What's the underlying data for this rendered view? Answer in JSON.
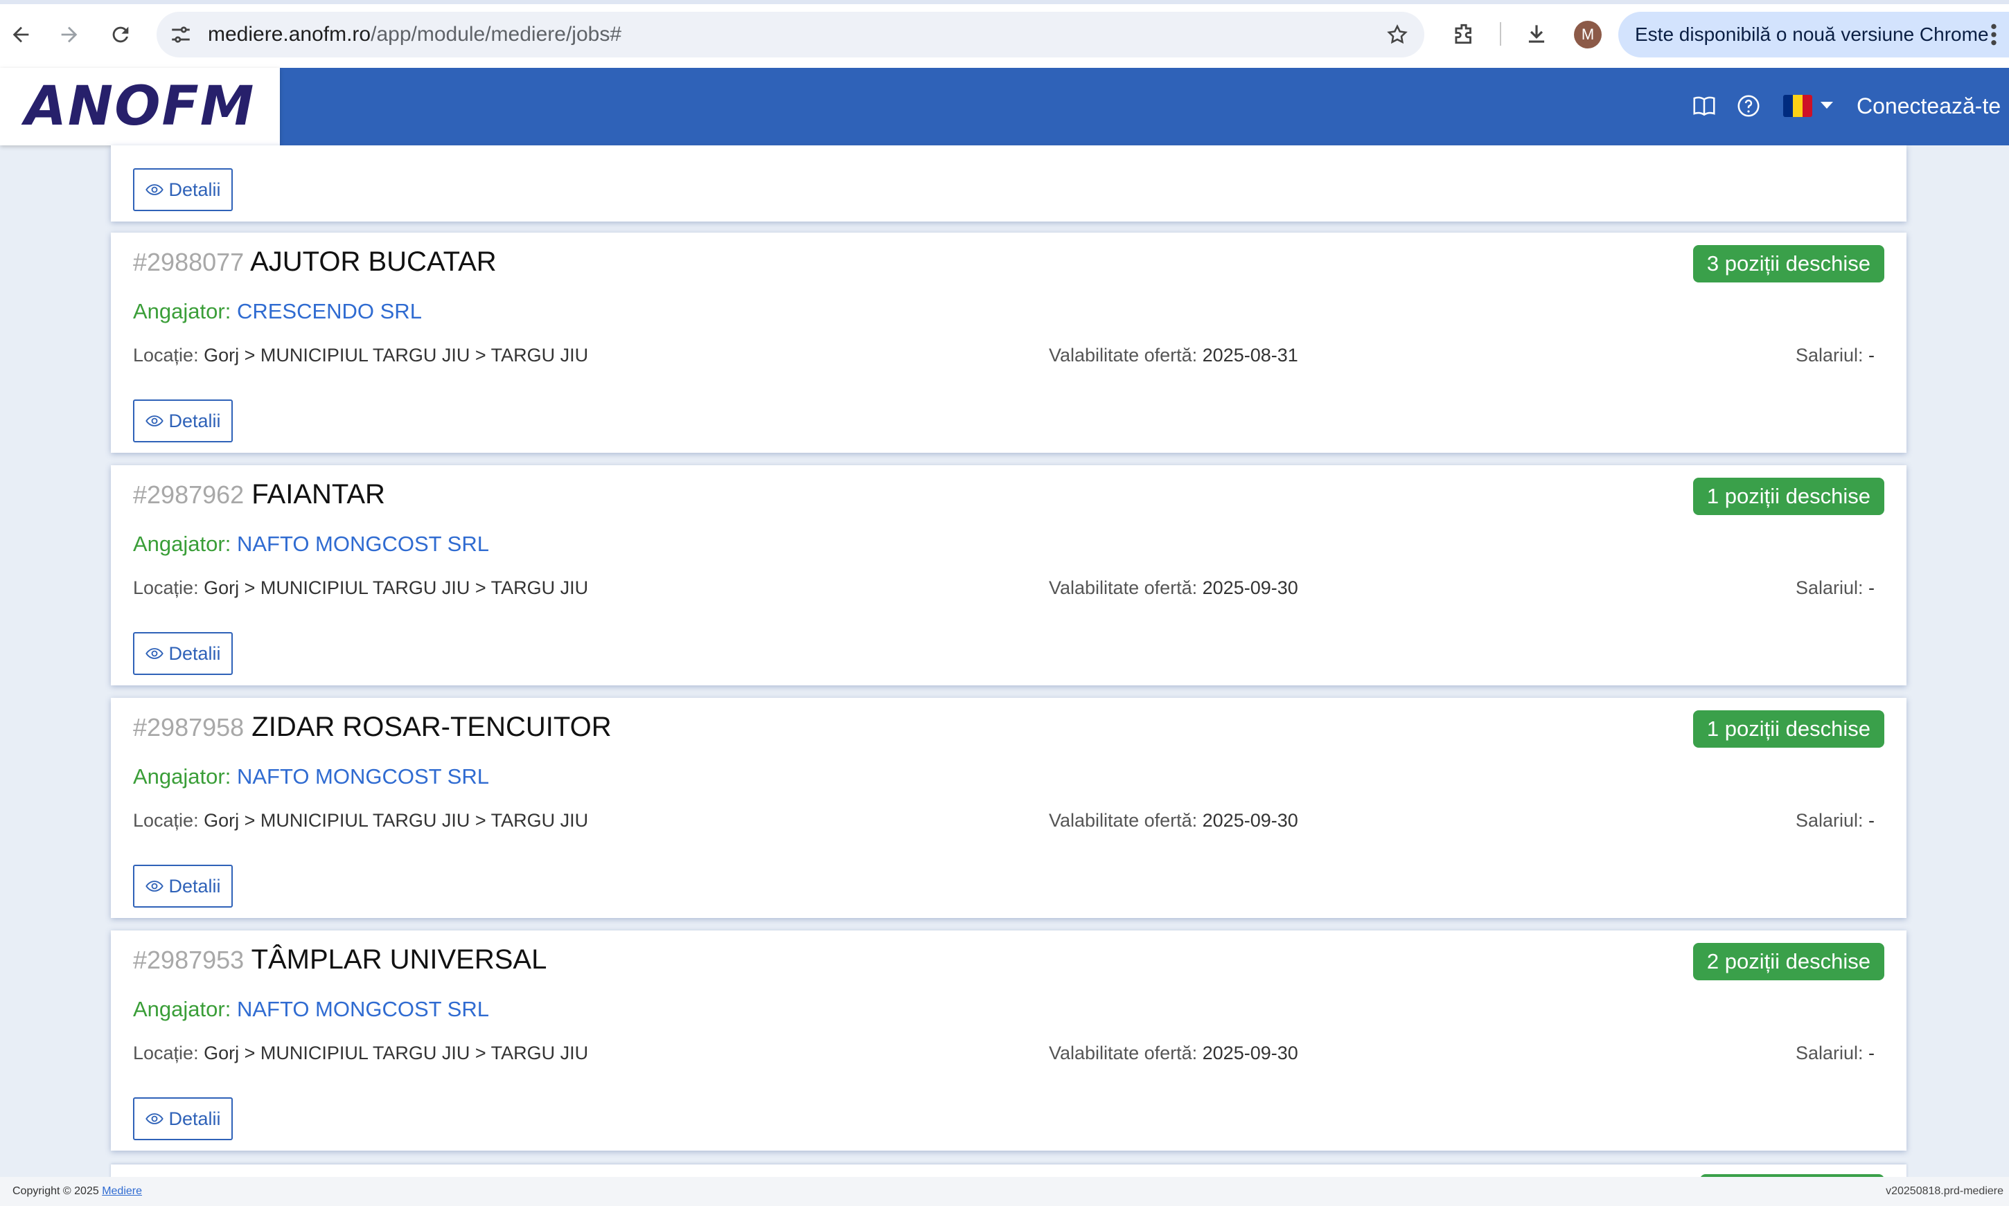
{
  "browser": {
    "url_host": "mediere.anofm.ro",
    "url_path": "/app/module/mediere/jobs#",
    "avatar_letter": "M",
    "update_notice": "Este disponibilă o nouă versiune Chrome"
  },
  "header": {
    "logo_text": "ANOFM",
    "login_label": "Conectează-te",
    "flag_colors": [
      "#002B7F",
      "#FCD116",
      "#CE1126"
    ]
  },
  "labels": {
    "employer": "Angajator: ",
    "location": "Locație: ",
    "validity": "Valabilitate ofertă: ",
    "salary": "Salariul: ",
    "details": "Detalii"
  },
  "jobs": [
    {
      "id": "#2988077",
      "title": "AJUTOR BUCATAR",
      "badge": "3 poziții deschise",
      "employer": "CRESCENDO SRL",
      "location": "Gorj > MUNICIPIUL TARGU JIU > TARGU JIU",
      "validity": "2025-08-31",
      "salary": "-"
    },
    {
      "id": "#2987962",
      "title": "FAIANTAR",
      "badge": "1 poziții deschise",
      "employer": "NAFTO MONGCOST SRL",
      "location": "Gorj > MUNICIPIUL TARGU JIU > TARGU JIU",
      "validity": "2025-09-30",
      "salary": "-"
    },
    {
      "id": "#2987958",
      "title": "ZIDAR ROSAR-TENCUITOR",
      "badge": "1 poziții deschise",
      "employer": "NAFTO MONGCOST SRL",
      "location": "Gorj > MUNICIPIUL TARGU JIU > TARGU JIU",
      "validity": "2025-09-30",
      "salary": "-"
    },
    {
      "id": "#2987953",
      "title": "TÂMPLAR UNIVERSAL",
      "badge": "2 poziții deschise",
      "employer": "NAFTO MONGCOST SRL",
      "location": "Gorj > MUNICIPIUL TARGU JIU > TARGU JIU",
      "validity": "2025-09-30",
      "salary": "-"
    }
  ],
  "footer": {
    "copyright_prefix": "Copyright © 2025 ",
    "copyright_link": "Mediere",
    "version": "v20250818.prd-mediere"
  }
}
